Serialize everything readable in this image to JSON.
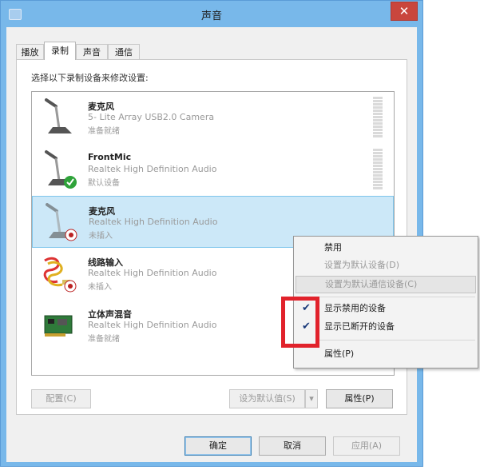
{
  "window": {
    "title": "声音",
    "close_glyph": "✕"
  },
  "tabs": [
    {
      "label": "播放",
      "active": false
    },
    {
      "label": "录制",
      "active": true
    },
    {
      "label": "声音",
      "active": false
    },
    {
      "label": "通信",
      "active": false
    }
  ],
  "panel": {
    "instruction": "选择以下录制设备来修改设置:"
  },
  "devices": [
    {
      "name": "麦克风",
      "description": "5- Lite Array USB2.0  Camera",
      "status": "准备就绪",
      "icon": "microphone-icon",
      "badge": ""
    },
    {
      "name": "FrontMic",
      "description": "Realtek High Definition Audio",
      "status": "默认设备",
      "icon": "microphone-icon",
      "badge": "default-check"
    },
    {
      "name": "麦克风",
      "description": "Realtek High Definition Audio",
      "status": "未插入",
      "icon": "microphone-icon",
      "badge": "unplugged"
    },
    {
      "name": "线路输入",
      "description": "Realtek High Definition Audio",
      "status": "未插入",
      "icon": "line-in-cable-icon",
      "badge": "unplugged"
    },
    {
      "name": "立体声混音",
      "description": "Realtek High Definition Audio",
      "status": "准备就绪",
      "icon": "sound-card-icon",
      "badge": ""
    }
  ],
  "buttons": {
    "configure": "配置(C)",
    "set_default": "设为默认值(S)",
    "dropdown_glyph": "▾",
    "properties": "属性(P)",
    "ok": "确定",
    "cancel": "取消",
    "apply": "应用(A)"
  },
  "context_menu": {
    "items": [
      {
        "label": "禁用",
        "disabled": false,
        "checked": false
      },
      {
        "label": "设置为默认设备(D)",
        "disabled": true,
        "checked": false
      },
      {
        "label": "设置为默认通信设备(C)",
        "disabled": true,
        "checked": false
      },
      {
        "label": "显示禁用的设备",
        "disabled": false,
        "checked": true
      },
      {
        "label": "显示已断开的设备",
        "disabled": false,
        "checked": true
      },
      {
        "label": "属性(P)",
        "disabled": false,
        "checked": false
      }
    ]
  },
  "colors": {
    "titlebar": "#78b8ea",
    "close": "#c9463d",
    "selection": "#cce8f8",
    "highlight_box": "#e1222b"
  }
}
